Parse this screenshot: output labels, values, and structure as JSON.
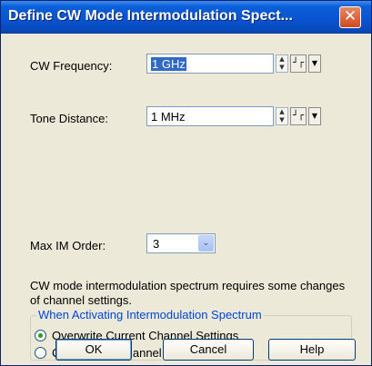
{
  "window": {
    "title": "Define CW Mode Intermodulation Spect...",
    "close_icon": "close-icon"
  },
  "fields": {
    "cw_frequency": {
      "label": "CW Frequency:",
      "value": "1 GHz",
      "selected": true
    },
    "tone_distance": {
      "label": "Tone Distance:",
      "value": "1 MHz"
    },
    "max_im_order": {
      "label": "Max IM Order:",
      "value": "3"
    }
  },
  "info_text": "CW mode intermodulation spectrum requires some changes of channel settings.",
  "activation_group": {
    "legend": "When Activating Intermodulation Spectrum",
    "options": [
      {
        "label": "Overwrite Current Channel Settings",
        "checked": true
      },
      {
        "label": "Create New Channel",
        "checked": false
      }
    ]
  },
  "buttons": {
    "ok": "OK",
    "cancel": "Cancel",
    "help": "Help"
  },
  "icons": {
    "spin": "spin-updown-icon",
    "step": "step-icon",
    "dropdown": "dropdown-arrow-icon"
  },
  "colors": {
    "titlebar": "#0954d0",
    "close_button": "#d04a1f",
    "dialog_background": "#ece9d8",
    "selection": "#316ac5",
    "group_legend": "#0046d5",
    "radio_dot": "#21a121"
  }
}
